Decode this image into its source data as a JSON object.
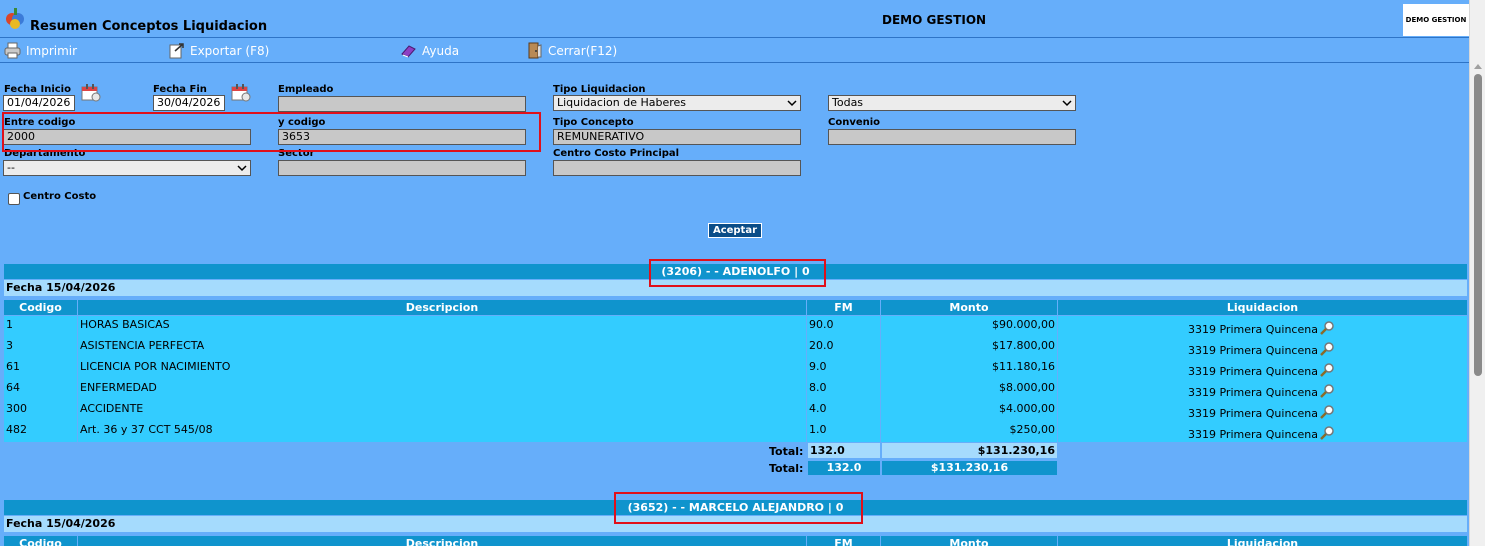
{
  "app": {
    "title": "Resumen Conceptos Liquidacion",
    "center_title": "DEMO GESTION",
    "brand_label": "DEMO GESTION"
  },
  "toolbar": {
    "print": "Imprimir",
    "export": "Exportar (F8)",
    "help": "Ayuda",
    "close": "Cerrar(F12)"
  },
  "filters": {
    "fecha_inicio_label": "Fecha Inicio",
    "fecha_inicio": "01/04/2026",
    "fecha_fin_label": "Fecha Fin",
    "fecha_fin": "30/04/2026",
    "empleado_label": "Empleado",
    "empleado": "",
    "tipo_liquidacion_label": "Tipo Liquidacion",
    "tipo_liquidacion": "Liquidacion de Haberes",
    "todas": "Todas",
    "entre_codigo_label": "Entre codigo",
    "entre_codigo": "2000",
    "y_codigo_label": "y codigo",
    "y_codigo": "3653",
    "tipo_concepto_label": "Tipo Concepto",
    "tipo_concepto": "REMUNERATIVO",
    "convenio_label": "Convenio",
    "convenio": "",
    "departamento_label": "Departamento",
    "departamento": "--",
    "sector_label": "Sector",
    "sector": "",
    "centro_costo_principal_label": "Centro Costo Principal",
    "centro_costo_principal": "",
    "centro_costo_label": "Centro Costo",
    "accept": "Aceptar"
  },
  "columns": [
    "Codigo",
    "Descripcion",
    "FM",
    "Monto",
    "Liquidacion"
  ],
  "groups": [
    {
      "header": "(3206) - - ADENOLFO | 0",
      "date": "Fecha 15/04/2026",
      "rows": [
        {
          "codigo": "1",
          "descripcion": "HORAS BASICAS",
          "fm": "90.0",
          "monto": "$90.000,00",
          "liquidacion": "3319 Primera Quincena"
        },
        {
          "codigo": "3",
          "descripcion": "ASISTENCIA PERFECTA",
          "fm": "20.0",
          "monto": "$17.800,00",
          "liquidacion": "3319 Primera Quincena"
        },
        {
          "codigo": "61",
          "descripcion": "LICENCIA POR NACIMIENTO",
          "fm": "9.0",
          "monto": "$11.180,16",
          "liquidacion": "3319 Primera Quincena"
        },
        {
          "codigo": "64",
          "descripcion": "ENFERMEDAD",
          "fm": "8.0",
          "monto": "$8.000,00",
          "liquidacion": "3319 Primera Quincena"
        },
        {
          "codigo": "300",
          "descripcion": "ACCIDENTE",
          "fm": "4.0",
          "monto": "$4.000,00",
          "liquidacion": "3319 Primera Quincena"
        },
        {
          "codigo": "482",
          "descripcion": "Art. 36 y 37 CCT 545/08",
          "fm": "1.0",
          "monto": "$250,00",
          "liquidacion": "3319 Primera Quincena"
        }
      ],
      "total_label": "Total:",
      "total_fm": "132.0",
      "total_monto": "$131.230,16",
      "total2_label": "Total:",
      "total2_fm": "132.0",
      "total2_monto": "$131.230,16"
    },
    {
      "header": "(3652) - - MARCELO ALEJANDRO | 0",
      "date": "Fecha 15/04/2026"
    }
  ]
}
